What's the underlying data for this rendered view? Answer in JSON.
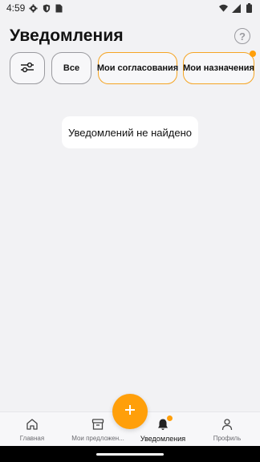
{
  "status_bar": {
    "time": "4:59",
    "left_icons": [
      "gear-icon",
      "shield-icon",
      "sim-card-icon"
    ],
    "right_icons": [
      "wifi-icon",
      "signal-icon",
      "battery-icon"
    ]
  },
  "header": {
    "title": "Уведомления",
    "help_icon": "question-circle-icon",
    "help_symbol": "?"
  },
  "filters": {
    "settings_icon": "sliders-icon",
    "chips": [
      {
        "label": "Все",
        "style": "gray"
      },
      {
        "label": "Мои согласования",
        "style": "orange"
      },
      {
        "label": "Мои назначения",
        "style": "orange",
        "has_dot": true
      }
    ]
  },
  "empty_state": {
    "message": "Уведомлений не найдено"
  },
  "bottom_nav": {
    "items": [
      {
        "label": "Главная",
        "icon": "home-icon",
        "active": false
      },
      {
        "label": "Мои предложен...",
        "icon": "archive-box-icon",
        "active": false
      },
      {
        "label": "Уведомления",
        "icon": "bell-icon",
        "active": true,
        "has_dot": true
      },
      {
        "label": "Профиль",
        "icon": "person-icon",
        "active": false
      }
    ],
    "fab_icon": "plus-icon"
  },
  "colors": {
    "accent": "#ff9f0a",
    "chip_border_active": "#f5a524",
    "chip_border_default": "#9a9a9f",
    "background": "#f2f2f4"
  }
}
